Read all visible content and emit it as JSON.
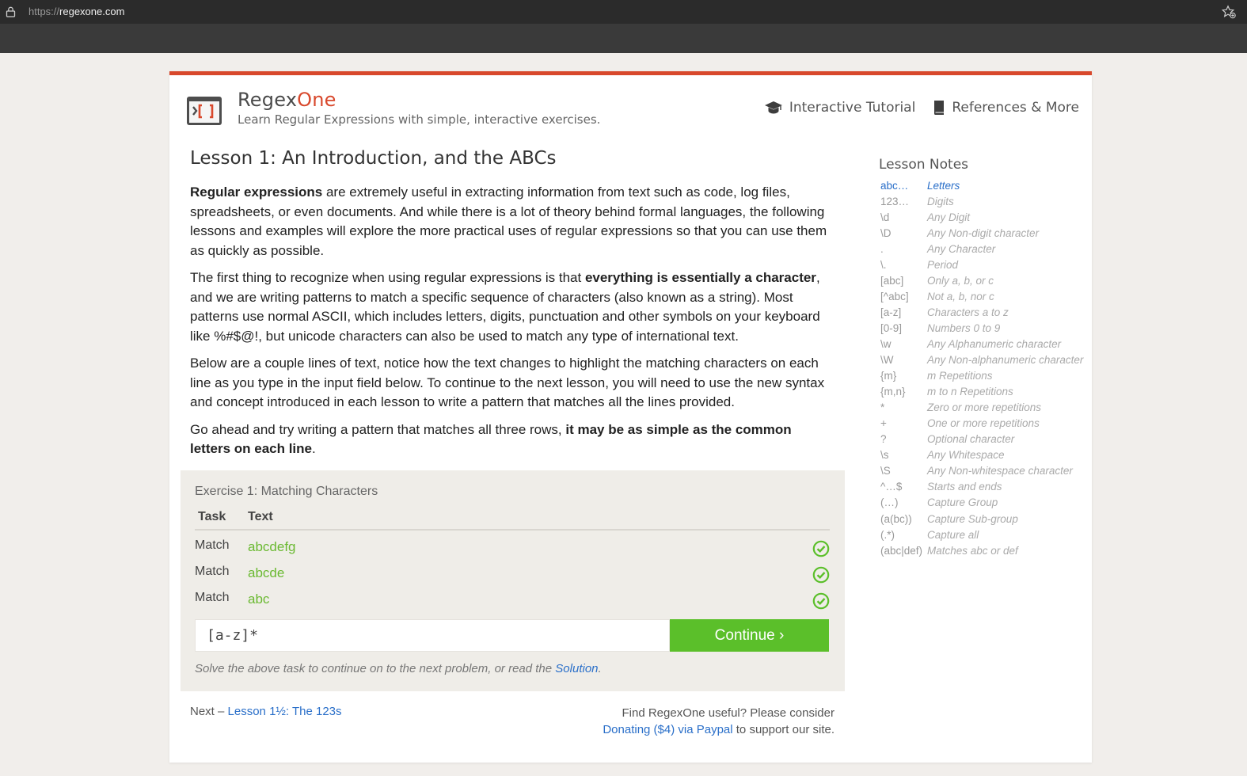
{
  "browser": {
    "url_scheme": "https://",
    "url_host": "regexone.com"
  },
  "header": {
    "brand_main": "Regex",
    "brand_accent": "One",
    "tagline": "Learn Regular Expressions with simple, interactive exercises.",
    "nav": [
      {
        "label": "Interactive Tutorial",
        "icon": "graduation-cap-icon"
      },
      {
        "label": "References & More",
        "icon": "book-icon"
      }
    ]
  },
  "lesson": {
    "title": "Lesson 1: An Introduction, and the ABCs",
    "paragraphs": [
      [
        {
          "t": "Regular expressions",
          "b": true
        },
        {
          "t": " are extremely useful in extracting information from text such as code, log files, spreadsheets, or even documents. And while there is a lot of theory behind formal languages, the following lessons and examples will explore the more practical uses of regular expressions so that you can use them as quickly as possible.",
          "b": false
        }
      ],
      [
        {
          "t": "The first thing to recognize when using regular expressions is that ",
          "b": false
        },
        {
          "t": "everything is essentially a character",
          "b": true
        },
        {
          "t": ", and we are writing patterns to match a specific sequence of characters (also known as a string). Most patterns use normal ASCII, which includes letters, digits, punctuation and other symbols on your keyboard like %#$@!, but unicode characters can also be used to match any type of international text.",
          "b": false
        }
      ],
      [
        {
          "t": "Below are a couple lines of text, notice how the text changes to highlight the matching characters on each line as you type in the input field below. To continue to the next lesson, you will need to use the new syntax and concept introduced in each lesson to write a pattern that matches all the lines provided.",
          "b": false
        }
      ],
      [
        {
          "t": "Go ahead and try writing a pattern that matches all three rows, ",
          "b": false
        },
        {
          "t": "it may be as simple as the common letters on each line",
          "b": true
        },
        {
          "t": ".",
          "b": false
        }
      ]
    ]
  },
  "exercise": {
    "title": "Exercise 1: Matching Characters",
    "col_task": "Task",
    "col_text": "Text",
    "rows": [
      {
        "task": "Match",
        "text": "abcdefg",
        "status": "check-circle-icon"
      },
      {
        "task": "Match",
        "text": "abcde",
        "status": "check-circle-icon"
      },
      {
        "task": "Match",
        "text": "abc",
        "status": "check-circle-icon"
      }
    ],
    "input_value": "[a-z]*",
    "continue_label": "Continue ›",
    "hint_prefix": "Solve the above task to continue on to the next problem, or read the ",
    "hint_link": "Solution",
    "hint_suffix": "."
  },
  "footer": {
    "next_prefix": "Next – ",
    "next_link": "Lesson 1½: The 123s",
    "donate_line1": "Find RegexOne useful? Please consider",
    "donate_link": "Donating ($4) via Paypal",
    "donate_suffix": " to support our site."
  },
  "notes": {
    "title": "Lesson Notes",
    "items": [
      {
        "k": "abc…",
        "v": "Letters",
        "active": true
      },
      {
        "k": "123…",
        "v": "Digits"
      },
      {
        "k": "\\d",
        "v": "Any Digit"
      },
      {
        "k": "\\D",
        "v": "Any Non-digit character"
      },
      {
        "k": ".",
        "v": "Any Character"
      },
      {
        "k": "\\.",
        "v": "Period"
      },
      {
        "k": "[abc]",
        "v": "Only a, b, or c"
      },
      {
        "k": "[^abc]",
        "v": "Not a, b, nor c"
      },
      {
        "k": "[a-z]",
        "v": "Characters a to z"
      },
      {
        "k": "[0-9]",
        "v": "Numbers 0 to 9"
      },
      {
        "k": "\\w",
        "v": "Any Alphanumeric character"
      },
      {
        "k": "\\W",
        "v": "Any Non-alphanumeric character"
      },
      {
        "k": "{m}",
        "v": "m Repetitions"
      },
      {
        "k": "{m,n}",
        "v": "m to n Repetitions"
      },
      {
        "k": "*",
        "v": "Zero or more repetitions"
      },
      {
        "k": "+",
        "v": "One or more repetitions"
      },
      {
        "k": "?",
        "v": "Optional character"
      },
      {
        "k": "\\s",
        "v": "Any Whitespace"
      },
      {
        "k": "\\S",
        "v": "Any Non-whitespace character"
      },
      {
        "k": "^…$",
        "v": "Starts and ends"
      },
      {
        "k": "(…)",
        "v": "Capture Group"
      },
      {
        "k": "(a(bc))",
        "v": "Capture Sub-group"
      },
      {
        "k": "(.*)",
        "v": "Capture all"
      },
      {
        "k": "(abc|def)",
        "v": "Matches abc or def"
      }
    ]
  },
  "colors": {
    "accent": "#d8482c",
    "match_green": "#6ab931",
    "button_green": "#5bbf2a",
    "link_blue": "#2a6fc9"
  }
}
